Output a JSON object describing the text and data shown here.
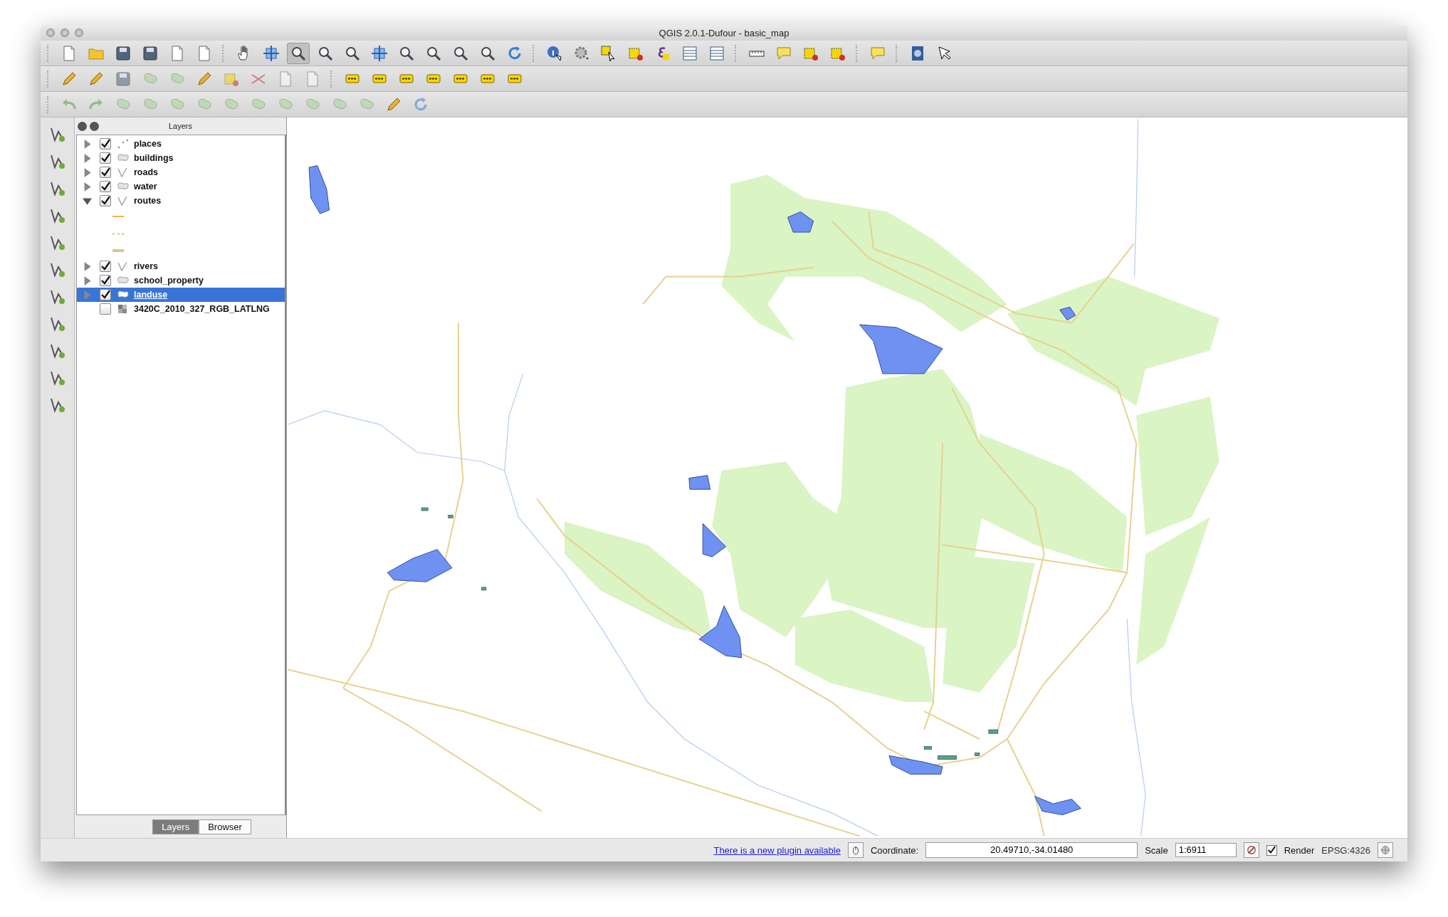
{
  "window": {
    "title": "QGIS 2.0.1-Dufour - basic_map"
  },
  "layers_panel": {
    "title": "Layers",
    "layers": [
      {
        "name": "places",
        "kind": "point",
        "checked": true,
        "expanded": false,
        "selected": false
      },
      {
        "name": "buildings",
        "kind": "polygon",
        "checked": true,
        "expanded": false,
        "selected": false
      },
      {
        "name": "roads",
        "kind": "line",
        "checked": true,
        "expanded": false,
        "selected": false
      },
      {
        "name": "water",
        "kind": "polygon",
        "checked": true,
        "expanded": false,
        "selected": false
      },
      {
        "name": "routes",
        "kind": "line",
        "checked": true,
        "expanded": true,
        "selected": false,
        "legend": [
          {
            "kind": "solid",
            "color": "#f0b447"
          },
          {
            "kind": "dotted",
            "color": "#e3d3a5"
          },
          {
            "kind": "thick",
            "color": "#dcc48e"
          }
        ]
      },
      {
        "name": "rivers",
        "kind": "line",
        "checked": true,
        "expanded": false,
        "selected": false
      },
      {
        "name": "school_property",
        "kind": "polygon",
        "checked": true,
        "expanded": false,
        "selected": false
      },
      {
        "name": "landuse",
        "kind": "polygon",
        "checked": true,
        "expanded": false,
        "selected": true
      },
      {
        "name": "3420C_2010_327_RGB_LATLNG",
        "kind": "raster",
        "checked": false,
        "selected": false
      }
    ],
    "tabs": [
      {
        "label": "Layers",
        "selected": true
      },
      {
        "label": "Browser",
        "selected": false
      }
    ]
  },
  "status_bar": {
    "plugin_link": "There is a new plugin available",
    "coordinate_label": "Coordinate:",
    "coordinate_value": "20.49710,-34.01480",
    "scale_label": "Scale",
    "scale_value": "1:6911",
    "render_label": "Render",
    "render_checked": true,
    "crs": "EPSG:4326"
  }
}
